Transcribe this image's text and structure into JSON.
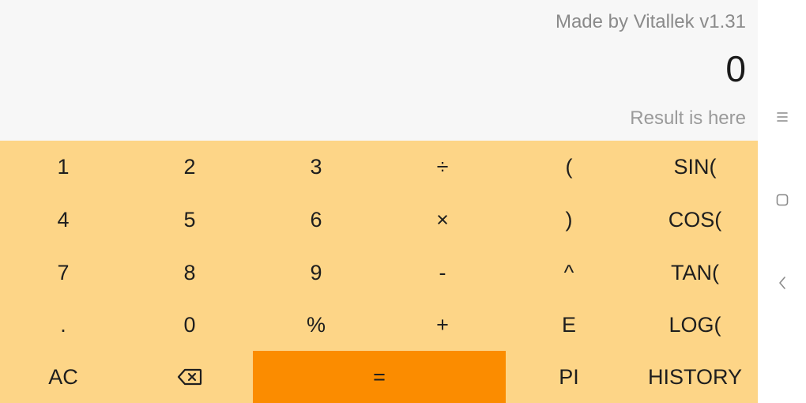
{
  "display": {
    "credit": "Made by Vitallek v1.31",
    "expression": "0",
    "result_placeholder": "Result is here"
  },
  "keypad": {
    "rows": [
      [
        "1",
        "2",
        "3",
        "÷",
        "(",
        "SIN("
      ],
      [
        "4",
        "5",
        "6",
        "×",
        ")",
        "COS("
      ],
      [
        "7",
        "8",
        "9",
        "-",
        "^",
        "TAN("
      ],
      [
        ".",
        "0",
        "%",
        "+",
        "E",
        "LOG("
      ]
    ],
    "bottom": {
      "clear": "AC",
      "backspace_icon": "backspace-icon",
      "equals": "=",
      "pi": "PI",
      "history": "HISTORY"
    }
  },
  "colors": {
    "display_bg": "#f7f7f7",
    "keypad_bg": "#fdd587",
    "equals_bg": "#fb8c00",
    "text_dark": "#1e1e1e",
    "text_muted": "#8a8a8a"
  },
  "navbar": {
    "icons": [
      "recents-icon",
      "home-icon",
      "back-icon"
    ]
  }
}
